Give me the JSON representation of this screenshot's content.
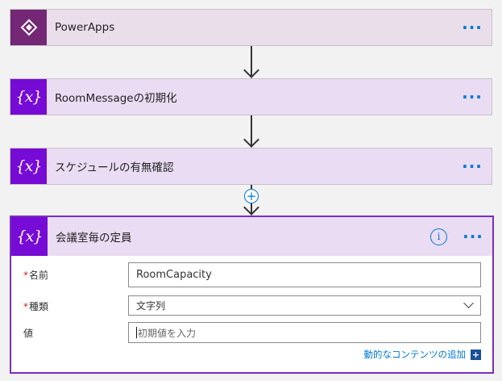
{
  "steps": [
    {
      "title": "PowerApps",
      "icon": "powerapps-icon"
    },
    {
      "title": "RoomMessageの初期化",
      "icon": "variable-icon"
    },
    {
      "title": "スケジュールの有無確認",
      "icon": "variable-icon"
    }
  ],
  "more_glyph": "···",
  "fx_glyph": "{x}",
  "add_glyph": "+",
  "info_glyph": "i",
  "expanded": {
    "title": "会議室毎の定員",
    "fields": {
      "name": {
        "label": "名前",
        "required": "*",
        "value": "RoomCapacity"
      },
      "type": {
        "label": "種類",
        "required": "*",
        "value": "文字列"
      },
      "value": {
        "label": "値",
        "placeholder": "初期値を入力"
      }
    },
    "dynamic_content_label": "動的なコンテンツの追加"
  },
  "colors": {
    "powerapps": "#742774",
    "variable": "#770bd6",
    "accent": "#0078d4"
  }
}
